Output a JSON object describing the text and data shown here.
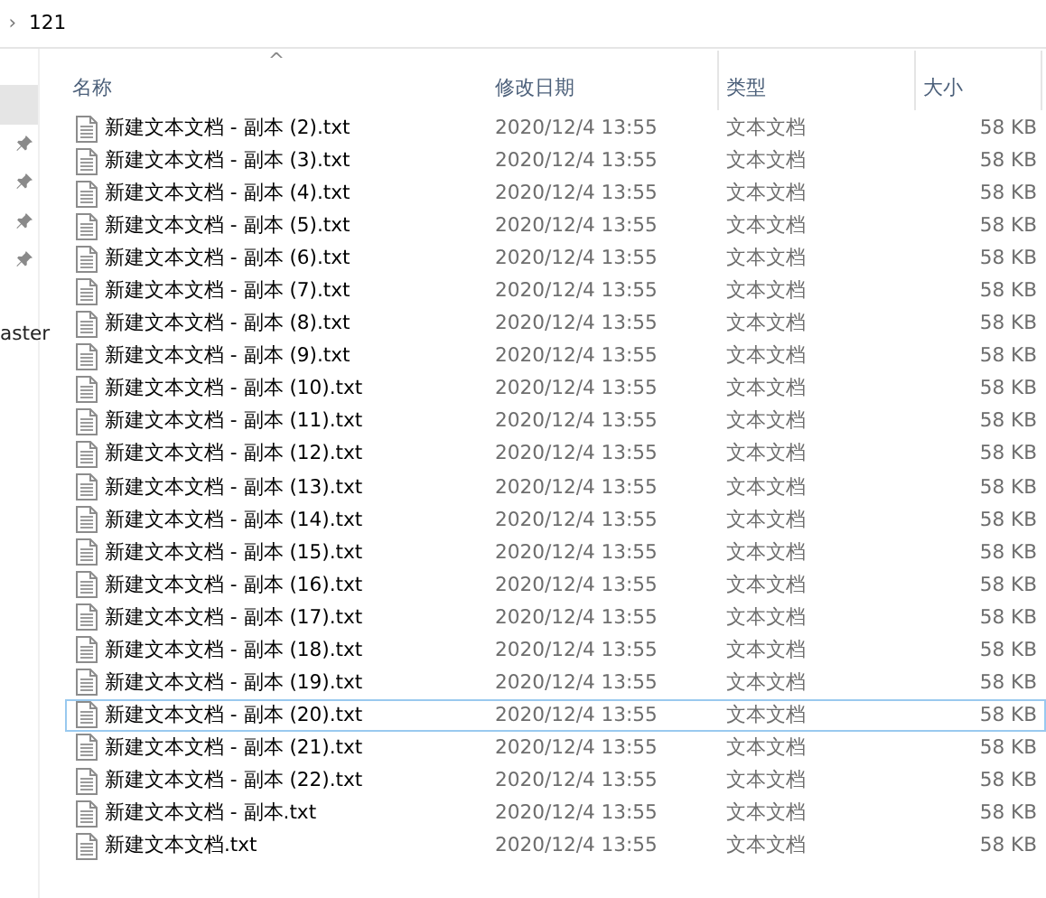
{
  "breadcrumb": {
    "separator": "›",
    "folder": "121"
  },
  "sidebar": {
    "items": [
      {
        "selected": true,
        "pinned": false
      },
      {
        "selected": false,
        "pinned": true
      },
      {
        "selected": false,
        "pinned": true
      },
      {
        "selected": false,
        "pinned": true
      },
      {
        "selected": false,
        "pinned": true
      },
      {
        "selected": false,
        "pinned": false,
        "label": "aster"
      }
    ]
  },
  "table": {
    "columns": [
      {
        "label": "名称",
        "sorted": true
      },
      {
        "label": "修改日期",
        "sorted": false
      },
      {
        "label": "类型",
        "sorted": false
      },
      {
        "label": "大小",
        "sorted": false
      }
    ],
    "sort_indicator": "^",
    "rows": [
      {
        "name": "新建文本文档 - 副本 (2).txt",
        "date": "2020/12/4 13:55",
        "type": "文本文档",
        "size": "58 KB",
        "selected": false
      },
      {
        "name": "新建文本文档 - 副本 (3).txt",
        "date": "2020/12/4 13:55",
        "type": "文本文档",
        "size": "58 KB",
        "selected": false
      },
      {
        "name": "新建文本文档 - 副本 (4).txt",
        "date": "2020/12/4 13:55",
        "type": "文本文档",
        "size": "58 KB",
        "selected": false
      },
      {
        "name": "新建文本文档 - 副本 (5).txt",
        "date": "2020/12/4 13:55",
        "type": "文本文档",
        "size": "58 KB",
        "selected": false
      },
      {
        "name": "新建文本文档 - 副本 (6).txt",
        "date": "2020/12/4 13:55",
        "type": "文本文档",
        "size": "58 KB",
        "selected": false
      },
      {
        "name": "新建文本文档 - 副本 (7).txt",
        "date": "2020/12/4 13:55",
        "type": "文本文档",
        "size": "58 KB",
        "selected": false
      },
      {
        "name": "新建文本文档 - 副本 (8).txt",
        "date": "2020/12/4 13:55",
        "type": "文本文档",
        "size": "58 KB",
        "selected": false
      },
      {
        "name": "新建文本文档 - 副本 (9).txt",
        "date": "2020/12/4 13:55",
        "type": "文本文档",
        "size": "58 KB",
        "selected": false
      },
      {
        "name": "新建文本文档 - 副本 (10).txt",
        "date": "2020/12/4 13:55",
        "type": "文本文档",
        "size": "58 KB",
        "selected": false
      },
      {
        "name": "新建文本文档 - 副本 (11).txt",
        "date": "2020/12/4 13:55",
        "type": "文本文档",
        "size": "58 KB",
        "selected": false
      },
      {
        "name": "新建文本文档 - 副本 (12).txt",
        "date": "2020/12/4 13:55",
        "type": "文本文档",
        "size": "58 KB",
        "selected": false
      },
      {
        "name": "新建文本文档 - 副本 (13).txt",
        "date": "2020/12/4 13:55",
        "type": "文本文档",
        "size": "58 KB",
        "selected": false
      },
      {
        "name": "新建文本文档 - 副本 (14).txt",
        "date": "2020/12/4 13:55",
        "type": "文本文档",
        "size": "58 KB",
        "selected": false
      },
      {
        "name": "新建文本文档 - 副本 (15).txt",
        "date": "2020/12/4 13:55",
        "type": "文本文档",
        "size": "58 KB",
        "selected": false
      },
      {
        "name": "新建文本文档 - 副本 (16).txt",
        "date": "2020/12/4 13:55",
        "type": "文本文档",
        "size": "58 KB",
        "selected": false
      },
      {
        "name": "新建文本文档 - 副本 (17).txt",
        "date": "2020/12/4 13:55",
        "type": "文本文档",
        "size": "58 KB",
        "selected": false
      },
      {
        "name": "新建文本文档 - 副本 (18).txt",
        "date": "2020/12/4 13:55",
        "type": "文本文档",
        "size": "58 KB",
        "selected": false
      },
      {
        "name": "新建文本文档 - 副本 (19).txt",
        "date": "2020/12/4 13:55",
        "type": "文本文档",
        "size": "58 KB",
        "selected": false
      },
      {
        "name": "新建文本文档 - 副本 (20).txt",
        "date": "2020/12/4 13:55",
        "type": "文本文档",
        "size": "58 KB",
        "selected": true
      },
      {
        "name": "新建文本文档 - 副本 (21).txt",
        "date": "2020/12/4 13:55",
        "type": "文本文档",
        "size": "58 KB",
        "selected": false
      },
      {
        "name": "新建文本文档 - 副本 (22).txt",
        "date": "2020/12/4 13:55",
        "type": "文本文档",
        "size": "58 KB",
        "selected": false
      },
      {
        "name": "新建文本文档 - 副本.txt",
        "date": "2020/12/4 13:55",
        "type": "文本文档",
        "size": "58 KB",
        "selected": false
      },
      {
        "name": "新建文本文档.txt",
        "date": "2020/12/4 13:55",
        "type": "文本文档",
        "size": "58 KB",
        "selected": false
      }
    ]
  }
}
